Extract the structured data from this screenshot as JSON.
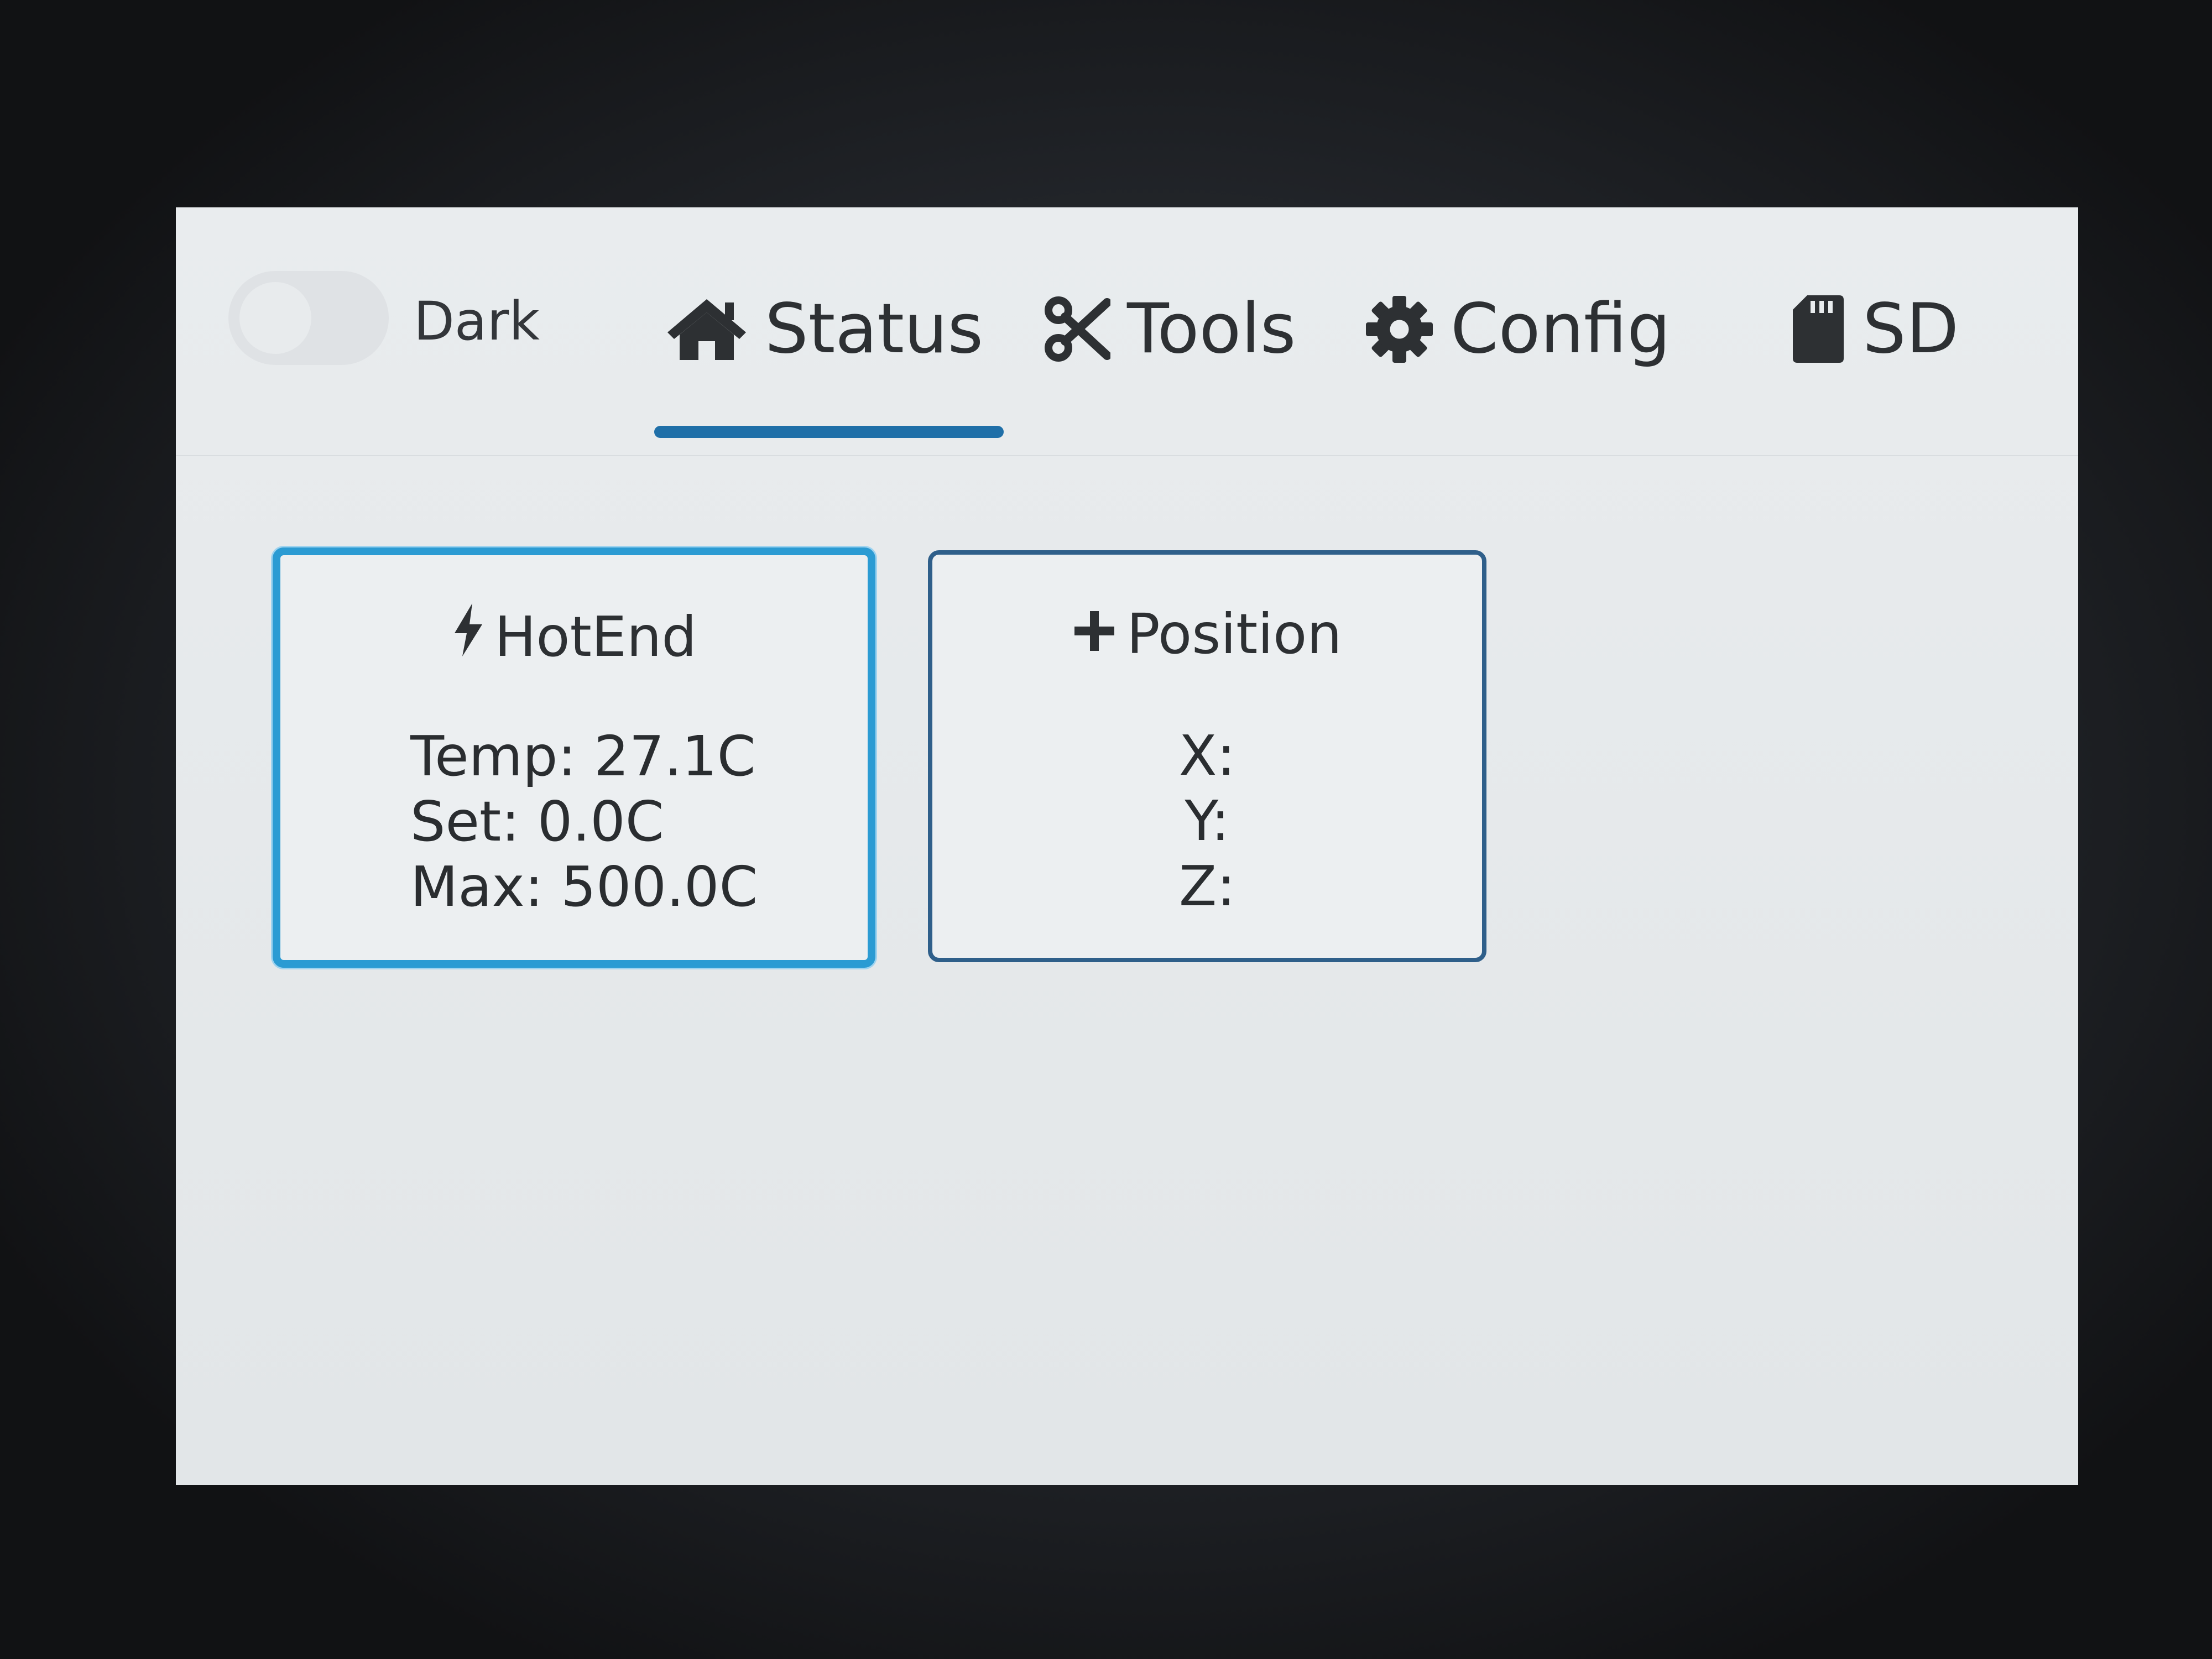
{
  "header": {
    "theme_toggle_label": "Dark",
    "tabs": [
      {
        "label": "Status",
        "icon": "home-icon",
        "active": true
      },
      {
        "label": "Tools",
        "icon": "scissors-icon",
        "active": false
      },
      {
        "label": "Config",
        "icon": "gear-icon",
        "active": false
      },
      {
        "label": "SD",
        "icon": "sd-card-icon",
        "active": false
      }
    ]
  },
  "accent_color": "#1f6fa8",
  "cards": {
    "hotend": {
      "title": "HotEnd",
      "icon": "bolt-icon",
      "lines": [
        "Temp: 27.1C",
        "Set: 0.0C",
        "Max: 500.0C"
      ]
    },
    "position": {
      "title": "Position",
      "icon": "plus-icon",
      "lines": [
        "X:",
        "Y:",
        "Z:"
      ]
    }
  }
}
